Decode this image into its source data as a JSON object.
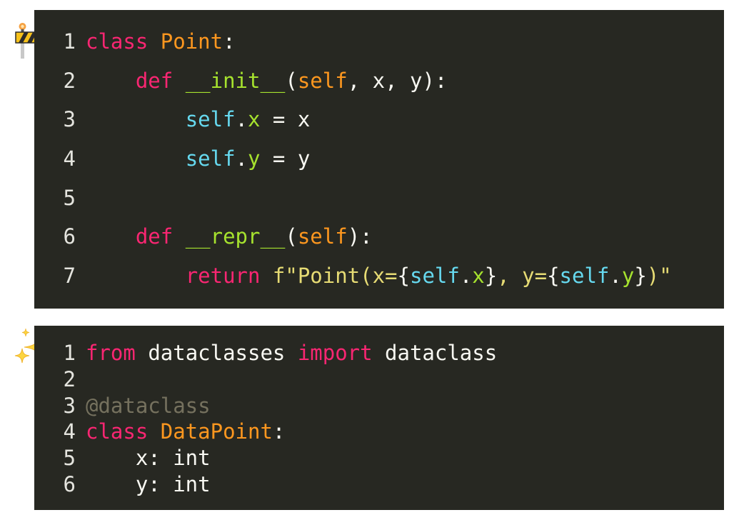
{
  "before": {
    "icon": "construction-barrier-icon",
    "lines": [
      {
        "n": "1",
        "tokens": [
          {
            "t": "class ",
            "c": "kw"
          },
          {
            "t": "Point",
            "c": "cls"
          },
          {
            "t": ":",
            "c": "plain"
          }
        ]
      },
      {
        "n": "2",
        "tokens": [
          {
            "t": "    ",
            "c": "plain"
          },
          {
            "t": "def ",
            "c": "kw"
          },
          {
            "t": "__init__",
            "c": "fn"
          },
          {
            "t": "(",
            "c": "plain"
          },
          {
            "t": "self",
            "c": "cls"
          },
          {
            "t": ", x, y):",
            "c": "plain"
          }
        ]
      },
      {
        "n": "3",
        "tokens": [
          {
            "t": "        ",
            "c": "plain"
          },
          {
            "t": "self",
            "c": "self"
          },
          {
            "t": ".",
            "c": "plain"
          },
          {
            "t": "x",
            "c": "attr"
          },
          {
            "t": " = x",
            "c": "plain"
          }
        ]
      },
      {
        "n": "4",
        "tokens": [
          {
            "t": "        ",
            "c": "plain"
          },
          {
            "t": "self",
            "c": "self"
          },
          {
            "t": ".",
            "c": "plain"
          },
          {
            "t": "y",
            "c": "attr"
          },
          {
            "t": " = y",
            "c": "plain"
          }
        ]
      },
      {
        "n": "5",
        "tokens": []
      },
      {
        "n": "6",
        "tokens": [
          {
            "t": "    ",
            "c": "plain"
          },
          {
            "t": "def ",
            "c": "kw"
          },
          {
            "t": "__repr__",
            "c": "fn"
          },
          {
            "t": "(",
            "c": "plain"
          },
          {
            "t": "self",
            "c": "cls"
          },
          {
            "t": "):",
            "c": "plain"
          }
        ]
      },
      {
        "n": "7",
        "tokens": [
          {
            "t": "        ",
            "c": "plain"
          },
          {
            "t": "return ",
            "c": "kw"
          },
          {
            "t": "f\"Point(x=",
            "c": "str"
          },
          {
            "t": "{",
            "c": "plain"
          },
          {
            "t": "self",
            "c": "self"
          },
          {
            "t": ".",
            "c": "plain"
          },
          {
            "t": "x",
            "c": "attr"
          },
          {
            "t": "}",
            "c": "plain"
          },
          {
            "t": ", y=",
            "c": "str"
          },
          {
            "t": "{",
            "c": "plain"
          },
          {
            "t": "self",
            "c": "self"
          },
          {
            "t": ".",
            "c": "plain"
          },
          {
            "t": "y",
            "c": "attr"
          },
          {
            "t": "}",
            "c": "plain"
          },
          {
            "t": ")\"",
            "c": "str"
          }
        ]
      }
    ]
  },
  "after": {
    "icon": "sparkles-icon",
    "lines": [
      {
        "n": "1",
        "tokens": [
          {
            "t": "from ",
            "c": "kw"
          },
          {
            "t": "dataclasses ",
            "c": "plain"
          },
          {
            "t": "import ",
            "c": "kw"
          },
          {
            "t": "dataclass",
            "c": "plain"
          }
        ]
      },
      {
        "n": "2",
        "tokens": []
      },
      {
        "n": "3",
        "tokens": [
          {
            "t": "@dataclass",
            "c": "cmt"
          }
        ]
      },
      {
        "n": "4",
        "tokens": [
          {
            "t": "class ",
            "c": "kw"
          },
          {
            "t": "DataPoint",
            "c": "cls"
          },
          {
            "t": ":",
            "c": "plain"
          }
        ]
      },
      {
        "n": "5",
        "tokens": [
          {
            "t": "    x: int",
            "c": "plain"
          }
        ]
      },
      {
        "n": "6",
        "tokens": [
          {
            "t": "    y: int",
            "c": "plain"
          }
        ]
      }
    ]
  },
  "colors": {
    "background": "#272822",
    "keyword": "#f92672",
    "class_name": "#fd971f",
    "function_name": "#a6e22e",
    "self": "#66d9ef",
    "string": "#e6db74",
    "text": "#f8f8f2",
    "decorator": "#75715e"
  }
}
